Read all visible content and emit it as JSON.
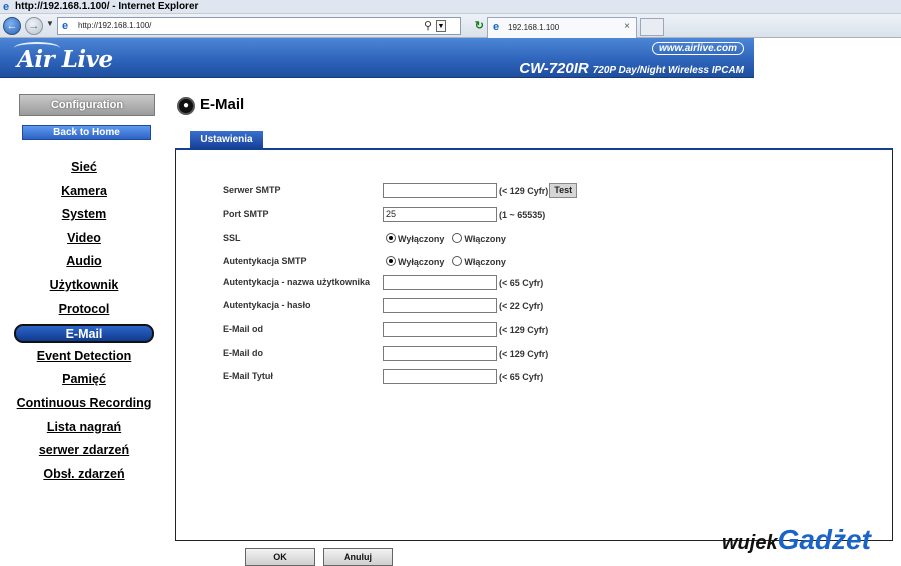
{
  "browser": {
    "window_title": "http://192.168.1.100/ - Internet Explorer",
    "address": "http://192.168.1.100/",
    "tab_label": "192.168.1.100",
    "tab_close": "×"
  },
  "banner": {
    "logo": "Air Live",
    "site": "www.airlive.com",
    "model": "CW-720IR",
    "model_desc": "720P Day/Night Wireless IPCAM"
  },
  "sidebar": {
    "configuration": "Configuration",
    "back_home": "Back to Home",
    "items": [
      {
        "label": "Sieć",
        "active": false
      },
      {
        "label": "Kamera",
        "active": false
      },
      {
        "label": "System",
        "active": false
      },
      {
        "label": "Video",
        "active": false
      },
      {
        "label": "Audio",
        "active": false
      },
      {
        "label": "Użytkownik",
        "active": false
      },
      {
        "label": "Protocol",
        "active": false
      },
      {
        "label": "E-Mail",
        "active": true
      },
      {
        "label": "Event Detection",
        "active": false
      },
      {
        "label": "Pamięć",
        "active": false
      },
      {
        "label": "Continuous Recording",
        "active": false
      },
      {
        "label": "Lista nagrań",
        "active": false
      },
      {
        "label": "serwer zdarzeń",
        "active": false
      },
      {
        "label": "Obsł. zdarzeń",
        "active": false
      }
    ]
  },
  "main": {
    "heading": "E-Mail",
    "tab": "Ustawienia",
    "fields": {
      "smtp_server": {
        "label": "Serwer SMTP",
        "value": "",
        "hint": "(< 129 Cyfr)",
        "test": "Test"
      },
      "smtp_port": {
        "label": "Port SMTP",
        "value": "25",
        "hint": "(1 ~ 65535)"
      },
      "ssl": {
        "label": "SSL",
        "options": [
          "Wyłączony",
          "Włączony"
        ],
        "selected": "Wyłączony"
      },
      "smtp_auth": {
        "label": "Autentykacja SMTP",
        "options": [
          "Wyłączony",
          "Włączony"
        ],
        "selected": "Wyłączony"
      },
      "auth_user": {
        "label": "Autentykacja - nazwa użytkownika",
        "value": "",
        "hint": "(< 65 Cyfr)"
      },
      "auth_pass": {
        "label": "Autentykacja - hasło",
        "value": "",
        "hint": "(< 22 Cyfr)"
      },
      "mail_from": {
        "label": "E-Mail od",
        "value": "",
        "hint": "(< 129 Cyfr)"
      },
      "mail_to": {
        "label": "E-Mail do",
        "value": "",
        "hint": "(< 129 Cyfr)"
      },
      "mail_subject": {
        "label": "E-Mail Tytuł",
        "value": "",
        "hint": "(< 65 Cyfr)"
      }
    },
    "ok": "OK",
    "cancel": "Anuluj"
  },
  "watermark": {
    "part1": "wujek",
    "part2": "Gadżet"
  },
  "colors": {
    "accent": "#2c62b8",
    "active_nav": "#0f3a8f"
  },
  "icons": {
    "back": "back-arrow-icon",
    "forward": "forward-arrow-icon",
    "page": "ie-page-icon",
    "heading": "email-section-icon"
  }
}
